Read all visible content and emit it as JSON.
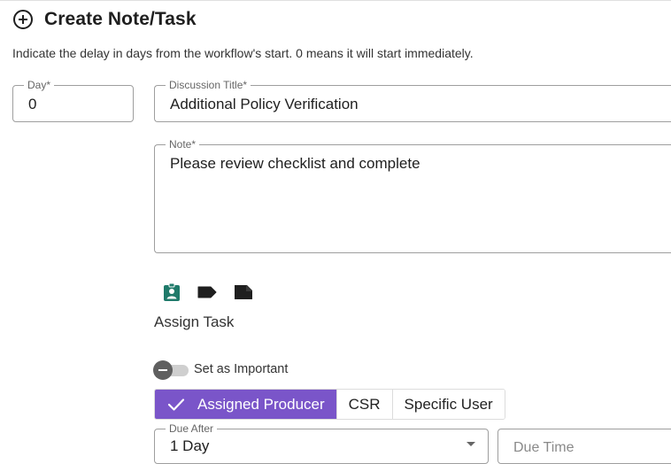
{
  "header": {
    "title": "Create Note/Task",
    "icon": "add-circle-icon"
  },
  "description": "Indicate the delay in days from the workflow's start. 0 means it will start immediately.",
  "form": {
    "day": {
      "label": "Day*",
      "value": "0"
    },
    "discussion_title": {
      "label": "Discussion Title*",
      "value": "Additional Policy Verification"
    },
    "note": {
      "label": "Note*",
      "value": "Please review checklist and complete"
    }
  },
  "note_icons": [
    {
      "name": "assign-task-icon",
      "color": "#1f7a6a"
    },
    {
      "name": "label-tag-icon",
      "color": "#1f1f1f"
    },
    {
      "name": "note-icon",
      "color": "#1f1f1f"
    }
  ],
  "assign_task": {
    "label": "Assign Task"
  },
  "important_toggle": {
    "label": "Set as Important",
    "checked": false
  },
  "assignee": {
    "options": [
      "Assigned Producer",
      "CSR",
      "Specific User"
    ],
    "selected": "Assigned Producer",
    "accent": "#7a55c9"
  },
  "due": {
    "due_after": {
      "label": "Due After",
      "value": "1 Day"
    },
    "due_time": {
      "placeholder": "Due Time"
    }
  }
}
